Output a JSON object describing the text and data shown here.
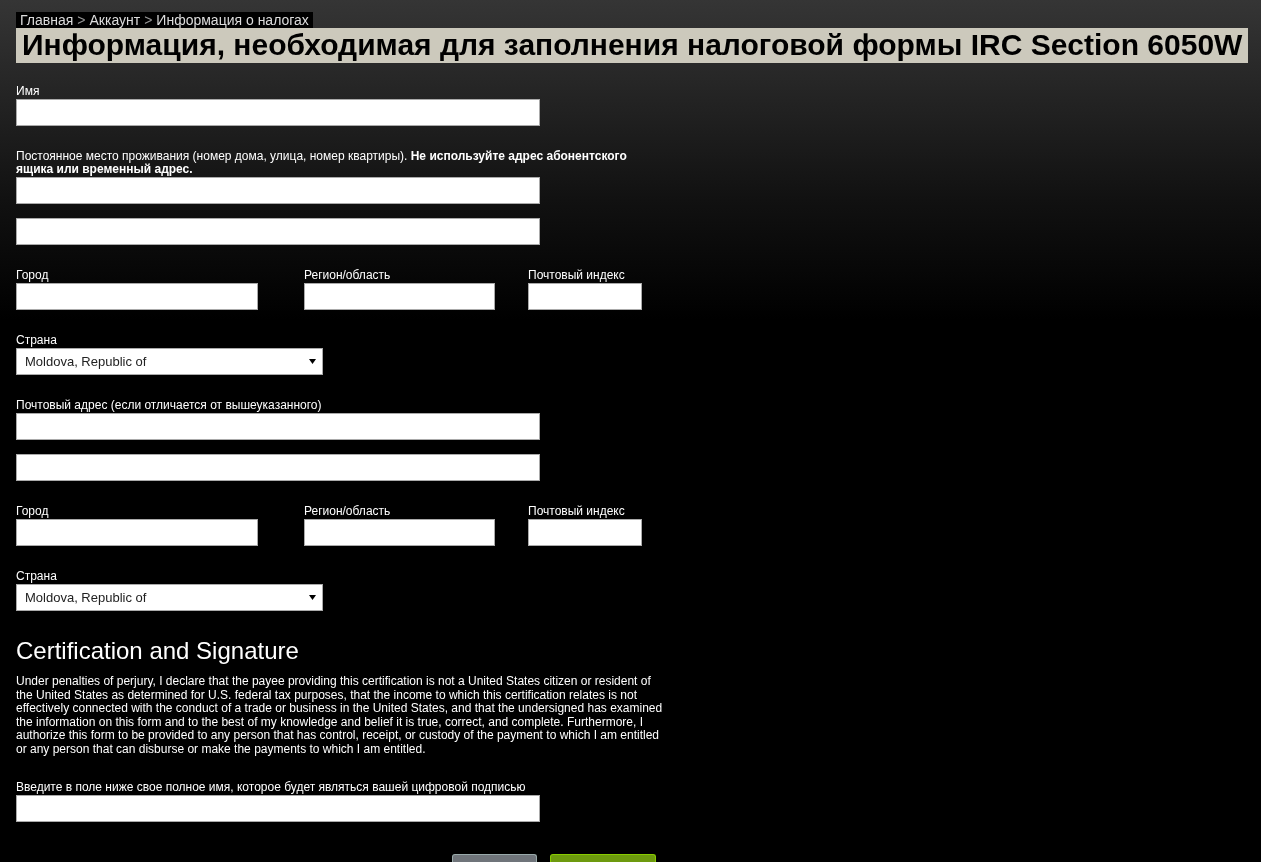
{
  "breadcrumb": [
    {
      "kind": "link",
      "text": "Главная"
    },
    {
      "kind": "separator",
      "text": ">"
    },
    {
      "kind": "link",
      "text": "Аккаунт"
    },
    {
      "kind": "separator",
      "text": ">"
    },
    {
      "kind": "current",
      "text": "Информация о налогах"
    }
  ],
  "title": "Информация, необходимая для заполнения налоговой формы IRC Section 6050W",
  "fields": [
    {
      "kind": "text",
      "label": "Имя"
    },
    {
      "kind": "text",
      "label": "Постоянное место проживания (номер дома, улица, номер квартиры). **Не используйте адрес абонентского ящика или временный адрес.**"
    },
    {
      "kind": "text"
    },
    {
      "kind": "row",
      "fields": [
        {
          "label": "Город"
        },
        {
          "label": "Регион/область"
        },
        {
          "label": "Почтовый индекс"
        }
      ]
    },
    {
      "kind": "select",
      "label": "Страна",
      "value": "Moldova, Republic of"
    },
    {
      "kind": "text",
      "label": "Почтовый адрес (если отличается от вышеуказанного)"
    },
    {
      "kind": "text"
    },
    {
      "kind": "row",
      "fields": [
        {
          "label": "Город"
        },
        {
          "label": "Регион/область"
        },
        {
          "label": "Почтовый индекс"
        }
      ]
    },
    {
      "kind": "select",
      "label": "Страна",
      "value": "Moldova, Republic of"
    }
  ],
  "certification": {
    "heading": "Certification and Signature",
    "text": "Under penalties of perjury, I declare that the payee providing this certification is not a United States citizen or resident of the United States as determined for U.S. federal tax purposes, that the income to which this certification relates is not effectively connected with the conduct of a trade or business in the United States, and that the undersigned has examined the information on this form and to the best of my knowledge and belief it is true, correct, and complete. Furthermore, I authorize this form to be provided to any person that has control, receipt, or custody of the payment to which I am entitled or any person that can disburse or make the payments to which I am entitled.",
    "signature_label": "Введите в поле ниже свое полное имя, которое будет являться вашей цифровой подписью"
  },
  "buttons": [
    {
      "kind": "secondary"
    },
    {
      "kind": "primary"
    }
  ]
}
